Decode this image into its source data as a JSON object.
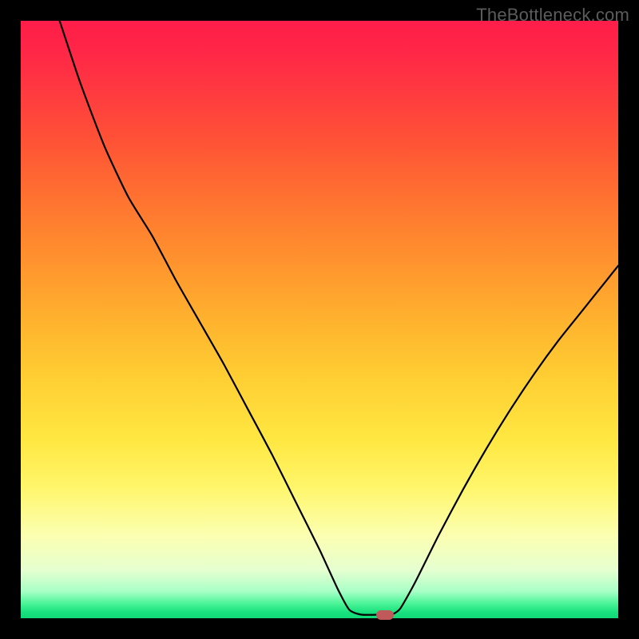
{
  "watermark": "TheBottleneck.com",
  "plot": {
    "inner_width": 748,
    "inner_height": 748,
    "x_range": [
      0,
      100
    ],
    "y_range": [
      0,
      100
    ]
  },
  "gradient": {
    "stops": [
      {
        "offset": 0.0,
        "color": "#ff1d49"
      },
      {
        "offset": 0.05,
        "color": "#ff2647"
      },
      {
        "offset": 0.12,
        "color": "#ff3a40"
      },
      {
        "offset": 0.2,
        "color": "#ff5236"
      },
      {
        "offset": 0.3,
        "color": "#ff7330"
      },
      {
        "offset": 0.4,
        "color": "#ff922e"
      },
      {
        "offset": 0.5,
        "color": "#ffb22e"
      },
      {
        "offset": 0.6,
        "color": "#ffcf33"
      },
      {
        "offset": 0.7,
        "color": "#ffe741"
      },
      {
        "offset": 0.78,
        "color": "#fff66a"
      },
      {
        "offset": 0.86,
        "color": "#fcffb0"
      },
      {
        "offset": 0.92,
        "color": "#e5ffd0"
      },
      {
        "offset": 0.955,
        "color": "#a8ffc7"
      },
      {
        "offset": 0.975,
        "color": "#4df598"
      },
      {
        "offset": 0.99,
        "color": "#18e07e"
      },
      {
        "offset": 1.0,
        "color": "#12d877"
      }
    ]
  },
  "chart_data": {
    "type": "line",
    "title": "",
    "xlabel": "",
    "ylabel": "",
    "xlim": [
      0,
      100
    ],
    "ylim": [
      0,
      100
    ],
    "series": [
      {
        "name": "bottleneck-curve",
        "points": [
          {
            "x": 6.5,
            "y": 100.0
          },
          {
            "x": 10.0,
            "y": 89.5
          },
          {
            "x": 14.0,
            "y": 79.0
          },
          {
            "x": 18.0,
            "y": 70.5
          },
          {
            "x": 22.0,
            "y": 64.0
          },
          {
            "x": 26.0,
            "y": 56.5
          },
          {
            "x": 30.0,
            "y": 49.5
          },
          {
            "x": 34.0,
            "y": 42.5
          },
          {
            "x": 38.0,
            "y": 35.0
          },
          {
            "x": 42.0,
            "y": 27.5
          },
          {
            "x": 46.0,
            "y": 19.5
          },
          {
            "x": 50.0,
            "y": 11.5
          },
          {
            "x": 53.0,
            "y": 5.0
          },
          {
            "x": 55.0,
            "y": 1.4
          },
          {
            "x": 57.0,
            "y": 0.6
          },
          {
            "x": 60.0,
            "y": 0.6
          },
          {
            "x": 62.0,
            "y": 0.6
          },
          {
            "x": 63.5,
            "y": 1.6
          },
          {
            "x": 66.0,
            "y": 6.0
          },
          {
            "x": 70.0,
            "y": 14.0
          },
          {
            "x": 74.0,
            "y": 21.5
          },
          {
            "x": 78.0,
            "y": 28.5
          },
          {
            "x": 82.0,
            "y": 35.0
          },
          {
            "x": 86.0,
            "y": 41.0
          },
          {
            "x": 90.0,
            "y": 46.5
          },
          {
            "x": 94.0,
            "y": 51.5
          },
          {
            "x": 98.0,
            "y": 56.5
          },
          {
            "x": 100.0,
            "y": 59.0
          }
        ]
      }
    ],
    "marker": {
      "x": 61.0,
      "y": 0.6,
      "color": "#c05a5a"
    }
  }
}
